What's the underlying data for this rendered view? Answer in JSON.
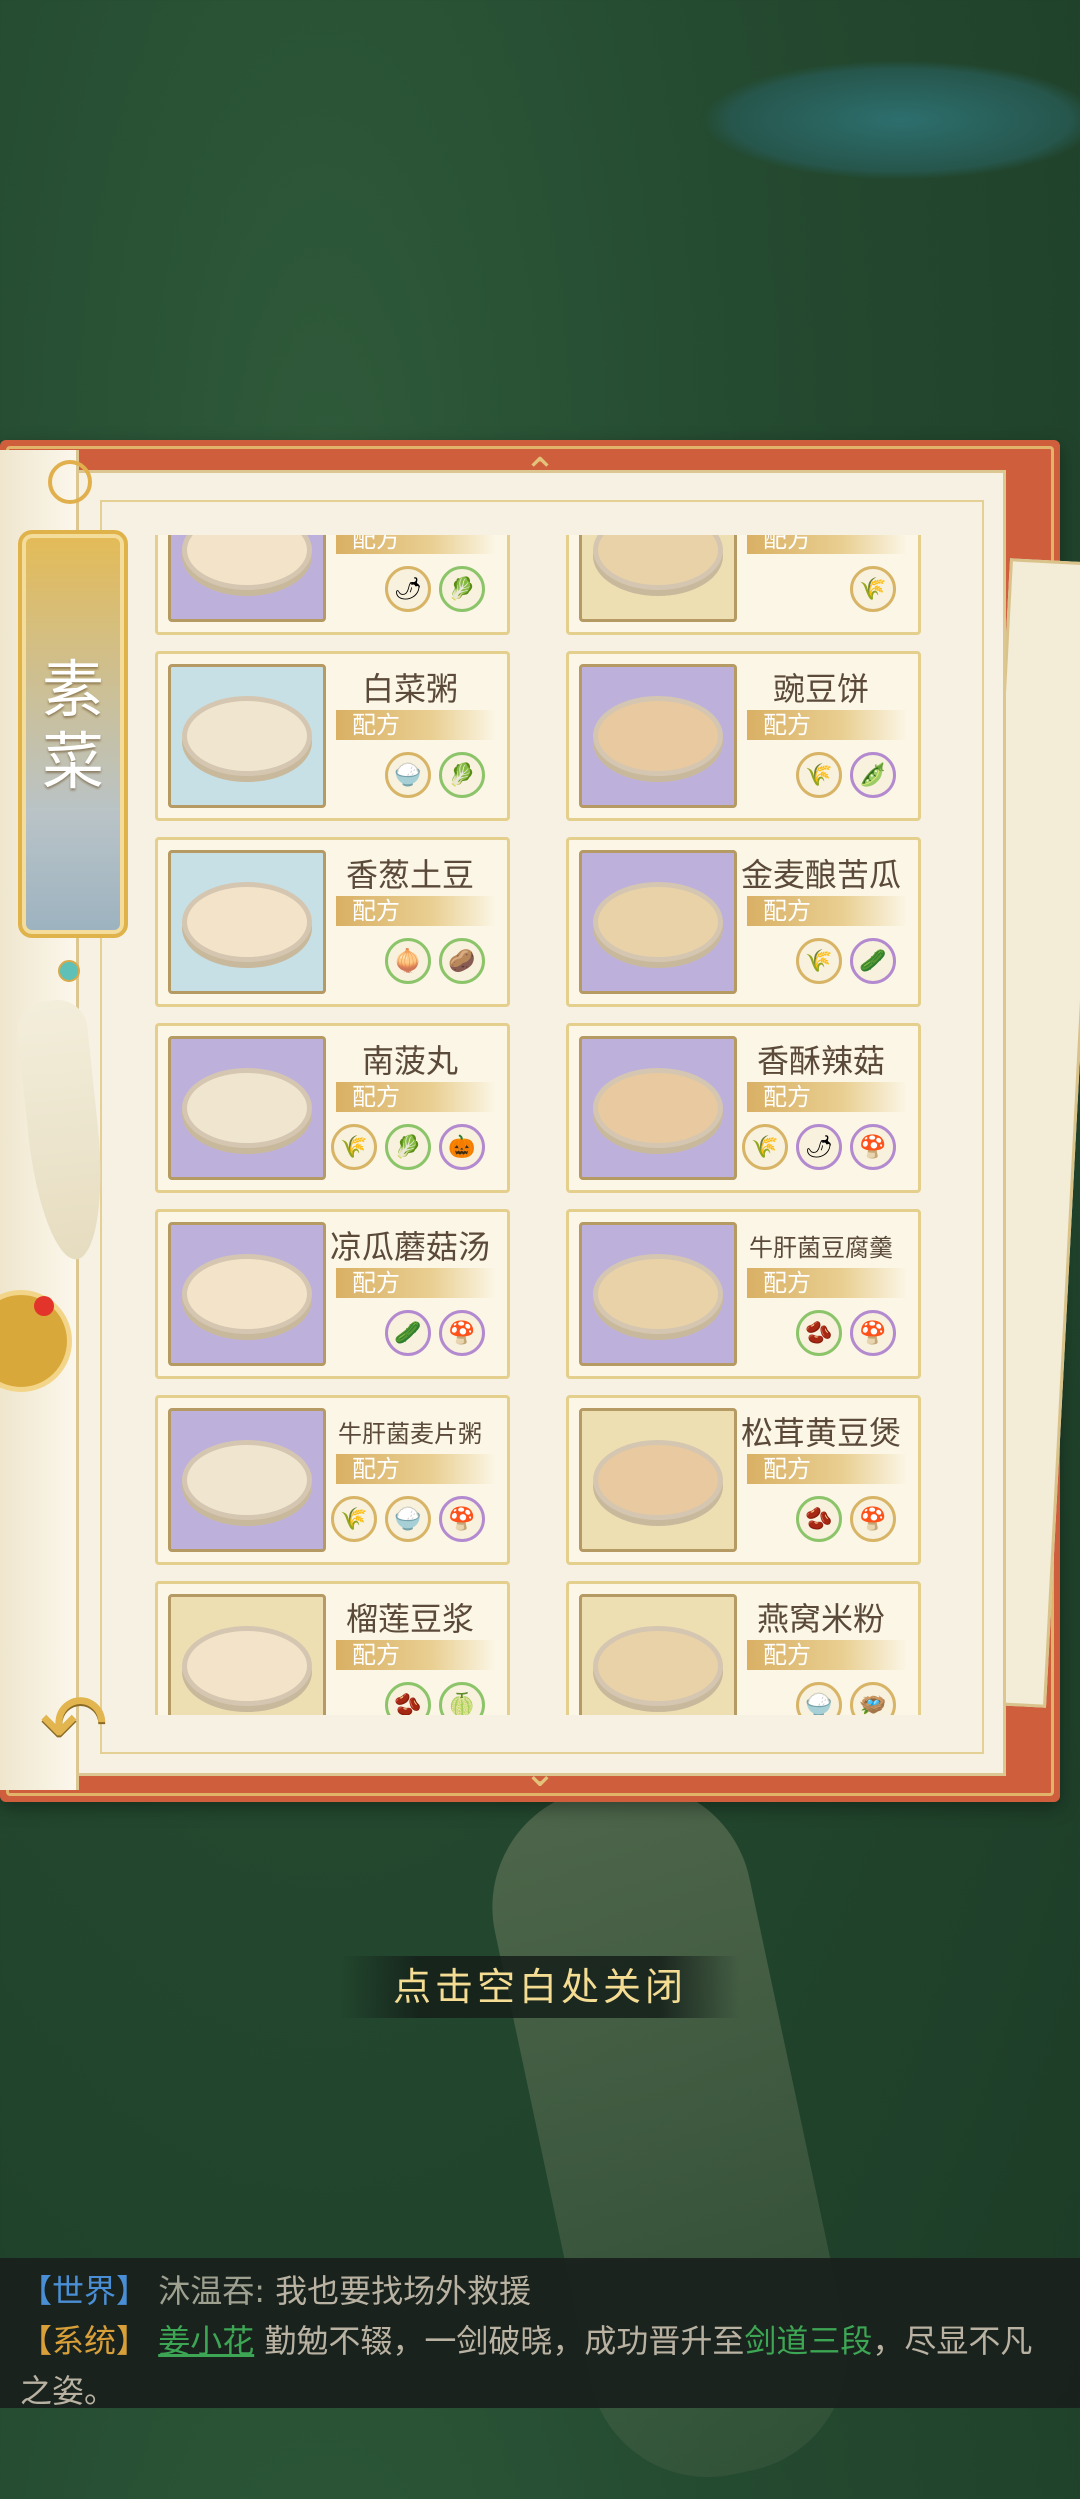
{
  "category": {
    "label": "素\n菜"
  },
  "recipe_label": "配方",
  "recipes": [
    {
      "name": "",
      "thumb": "purple",
      "ings": [
        {
          "c": "",
          "i": "🌶"
        },
        {
          "c": "g",
          "i": "🥬"
        }
      ]
    },
    {
      "name": "",
      "thumb": "gray",
      "ings": [
        {
          "c": "",
          "i": "🌾"
        }
      ]
    },
    {
      "name": "白菜粥",
      "thumb": "blue",
      "ings": [
        {
          "c": "",
          "i": "🍚"
        },
        {
          "c": "g",
          "i": "🥬"
        }
      ]
    },
    {
      "name": "豌豆饼",
      "thumb": "purple",
      "ings": [
        {
          "c": "",
          "i": "🌾"
        },
        {
          "c": "p",
          "i": "🫛"
        }
      ]
    },
    {
      "name": "香葱土豆",
      "thumb": "blue",
      "ings": [
        {
          "c": "g",
          "i": "🧅"
        },
        {
          "c": "g",
          "i": "🥔"
        }
      ]
    },
    {
      "name": "金麦酿苦瓜",
      "thumb": "purple",
      "ings": [
        {
          "c": "",
          "i": "🌾"
        },
        {
          "c": "p",
          "i": "🥒"
        }
      ]
    },
    {
      "name": "南菠丸",
      "thumb": "purple",
      "ings": [
        {
          "c": "",
          "i": "🌾"
        },
        {
          "c": "g",
          "i": "🥬"
        },
        {
          "c": "p",
          "i": "🎃"
        }
      ]
    },
    {
      "name": "香酥辣菇",
      "thumb": "purple",
      "ings": [
        {
          "c": "",
          "i": "🌾"
        },
        {
          "c": "p",
          "i": "🌶"
        },
        {
          "c": "p",
          "i": "🍄"
        }
      ]
    },
    {
      "name": "凉瓜蘑菇汤",
      "thumb": "purple",
      "ings": [
        {
          "c": "p",
          "i": "🥒"
        },
        {
          "c": "p",
          "i": "🍄"
        }
      ]
    },
    {
      "name": "牛肝菌豆腐羹",
      "thumb": "purple",
      "small": true,
      "ings": [
        {
          "c": "g",
          "i": "🫘"
        },
        {
          "c": "p",
          "i": "🍄"
        }
      ]
    },
    {
      "name": "牛肝菌麦片粥",
      "thumb": "purple",
      "small": true,
      "ings": [
        {
          "c": "",
          "i": "🌾"
        },
        {
          "c": "",
          "i": "🍚"
        },
        {
          "c": "p",
          "i": "🍄"
        }
      ]
    },
    {
      "name": "松茸黄豆煲",
      "thumb": "gold",
      "ings": [
        {
          "c": "g",
          "i": "🫘"
        },
        {
          "c": "",
          "i": "🍄"
        }
      ]
    },
    {
      "name": "榴莲豆浆",
      "thumb": "gold",
      "ings": [
        {
          "c": "g",
          "i": "🫘"
        },
        {
          "c": "g",
          "i": "🍈"
        }
      ]
    },
    {
      "name": "燕窝米粉",
      "thumb": "gold",
      "ings": [
        {
          "c": "",
          "i": "🍚"
        },
        {
          "c": "",
          "i": "🪺"
        }
      ]
    }
  ],
  "close_hint": "点击空白处关闭",
  "chat": {
    "line1": {
      "channel": "【世界】",
      "speaker": "沐温吞:",
      "text": "我也要找场外救援"
    },
    "line2": {
      "channel": "【系统】",
      "player": "姜小花",
      "text1": "勤勉不辍，一剑破晓，成功晋升至",
      "rank": "剑道三段",
      "text2": "，尽显不凡之姿。"
    }
  },
  "colors": {
    "book_red": "#cf5e3d",
    "gold": "#e2b46a",
    "page": "#f6f1e3"
  }
}
